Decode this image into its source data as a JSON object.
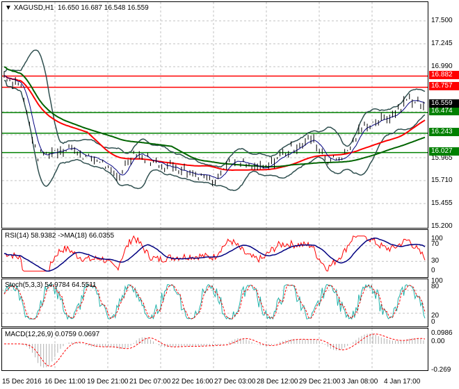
{
  "header": {
    "symbol": "XAGUSD,H1",
    "ohlc": "16.650 16.687 16.548 16.559"
  },
  "price_axis": [
    "17.500",
    "17.245",
    "16.990",
    "15.965",
    "15.710",
    "15.455",
    "15.200"
  ],
  "levels": [
    {
      "value": 16.882,
      "label": "16.882",
      "color": "#ff0000"
    },
    {
      "value": 16.757,
      "label": "16.757",
      "color": "#ff0000"
    },
    {
      "value": 16.474,
      "label": "16.474",
      "color": "#008000"
    },
    {
      "value": 16.243,
      "label": "16.243",
      "color": "#008000"
    },
    {
      "value": 16.027,
      "label": "16.027",
      "color": "#008000"
    }
  ],
  "current_price": {
    "value": 16.559,
    "label": "16.559"
  },
  "rsi": {
    "label": "RSI(14) 58.9382  ->MA(18) 66.0355",
    "axis": [
      "100",
      "70",
      "30",
      "0"
    ]
  },
  "stoch": {
    "label": "Stoch(5,3,3) 54.9784 64.5511",
    "axis": [
      "100",
      "80",
      "20",
      "0"
    ]
  },
  "macd": {
    "label": "MACD(12,26,9) 0.0759 0.0697",
    "axis": [
      "0.0986",
      "0.00",
      "-0.269"
    ]
  },
  "time_axis": [
    "15 Dec 2016",
    "16 Dec 11:00",
    "19 Dec 21:00",
    "21 Dec 07:00",
    "22 Dec 16:00",
    "27 Dec 03:00",
    "28 Dec 12:00",
    "29 Dec 21:00",
    "3 Jan 08:00",
    "4 Jan 17:00"
  ],
  "chart_data": {
    "type": "line",
    "price_path": [
      16.9,
      16.8,
      16.0,
      16.05,
      16.1,
      16.0,
      15.95,
      15.75,
      16.05,
      15.95,
      15.9,
      15.85,
      15.8,
      15.75,
      15.95,
      15.9,
      15.85,
      16.0,
      16.1,
      16.2,
      15.95,
      16.0,
      16.3,
      16.4,
      16.45,
      16.65,
      16.56
    ],
    "price_range": [
      15.2,
      17.6
    ]
  }
}
